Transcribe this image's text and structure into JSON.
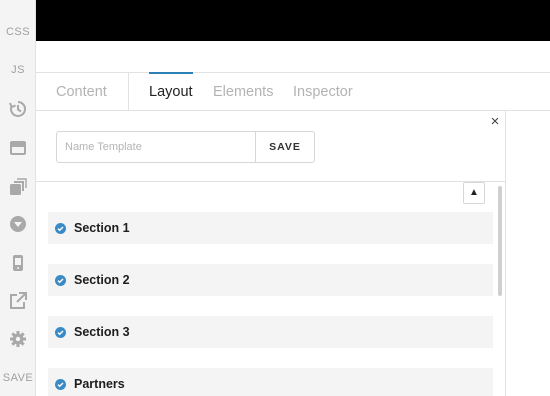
{
  "toolbar": {
    "css_label": "CSS",
    "js_label": "JS",
    "save_label": "SAVE"
  },
  "tabs": [
    {
      "label": "Content",
      "active": false
    },
    {
      "label": "Layout",
      "active": true
    },
    {
      "label": "Elements",
      "active": false
    },
    {
      "label": "Inspector",
      "active": false
    }
  ],
  "template": {
    "placeholder": "Name Template",
    "value": "",
    "save_label": "SAVE"
  },
  "close_glyph": "×",
  "scroll_up_glyph": "▲",
  "sections": [
    {
      "label": "Section 1",
      "checked": true
    },
    {
      "label": "Section 2",
      "checked": true
    },
    {
      "label": "Section 3",
      "checked": true
    },
    {
      "label": "Partners",
      "checked": true
    }
  ],
  "colors": {
    "accent": "#2d7fb8",
    "check": "#3a8bc5",
    "topbar": "#000000"
  }
}
